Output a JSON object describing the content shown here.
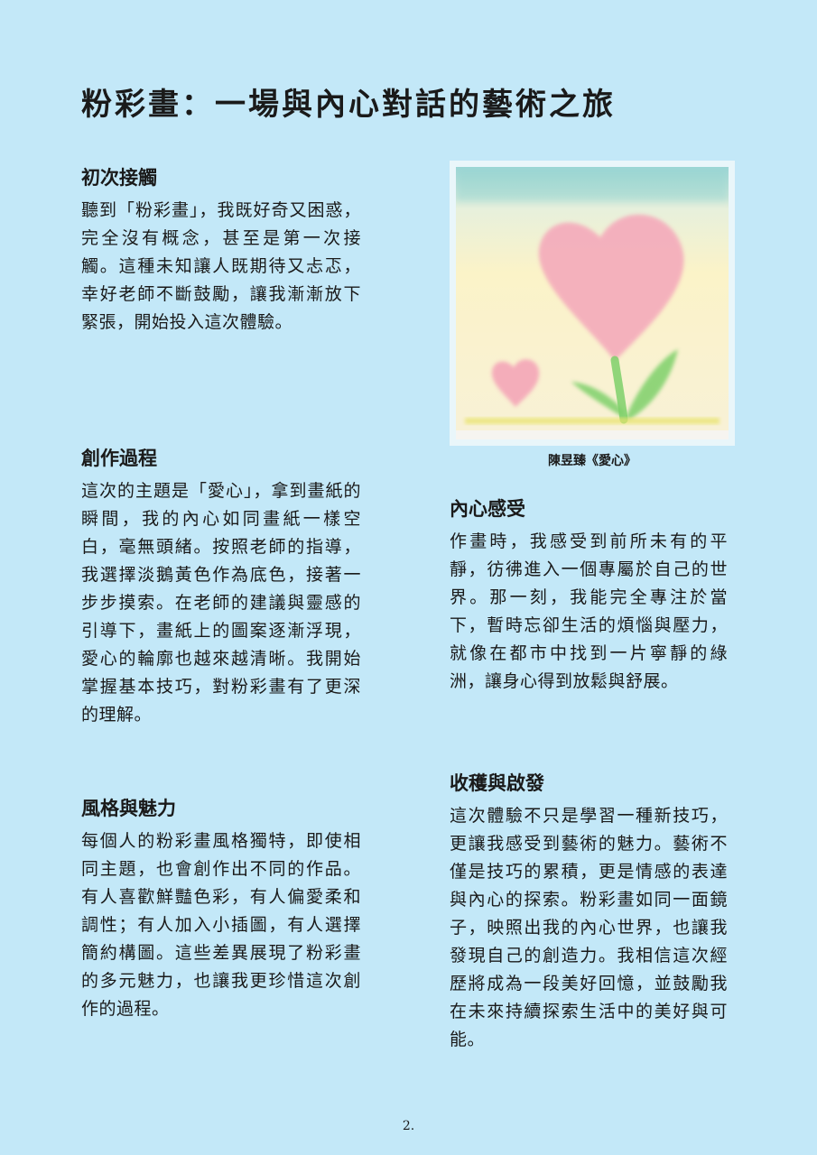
{
  "page": {
    "title": "粉彩畫：一場與內心對話的藝術之旅",
    "page_number": "2."
  },
  "artwork": {
    "caption": "陳昱臻《愛心》"
  },
  "sections": {
    "first_contact": {
      "heading": "初次接觸",
      "body": "聽到「粉彩畫」，我既好奇又困惑，完全沒有概念，甚至是第一次接觸。這種未知讓人既期待又忐忑，幸好老師不斷鼓勵，讓我漸漸放下緊張，開始投入這次體驗。"
    },
    "creation_process": {
      "heading": "創作過程",
      "body": "這次的主題是「愛心」，拿到畫紙的瞬間，我的內心如同畫紙一樣空白，毫無頭緒。按照老師的指導，我選擇淡鵝黃色作為底色，接著一步步摸索。在老師的建議與靈感的引導下，畫紙上的圖案逐漸浮現，愛心的輪廓也越來越清晰。我開始掌握基本技巧，對粉彩畫有了更深的理解。"
    },
    "style_charm": {
      "heading": "風格與魅力",
      "body": "每個人的粉彩畫風格獨特，即使相同主題，也會創作出不同的作品。有人喜歡鮮豔色彩，有人偏愛柔和調性；有人加入小插圖，有人選擇簡約構圖。這些差異展現了粉彩畫的多元魅力，也讓我更珍惜這次創作的過程。"
    },
    "inner_feeling": {
      "heading": "內心感受",
      "body": "作畫時，我感受到前所未有的平靜，彷彿進入一個專屬於自己的世界。那一刻，我能完全專注於當下，暫時忘卻生活的煩惱與壓力，就像在都市中找到一片寧靜的綠洲，讓身心得到放鬆與舒展。"
    },
    "harvest_inspiration": {
      "heading": "收穫與啟發",
      "body": "這次體驗不只是學習一種新技巧，更讓我感受到藝術的魅力。藝術不僅是技巧的累積，更是情感的表達與內心的探索。粉彩畫如同一面鏡子，映照出我的內心世界，也讓我發現自己的創造力。我相信這次經歷將成為一段美好回憶，並鼓勵我在未來持續探索生活中的美好與可能。"
    }
  },
  "colors": {
    "page_background": "#c3e8f8",
    "heart_pink": "#f4aabb",
    "stem_green": "#7ed06a",
    "sky_teal": "#8fd3cf",
    "paper_yellow": "#fbf3c8"
  }
}
